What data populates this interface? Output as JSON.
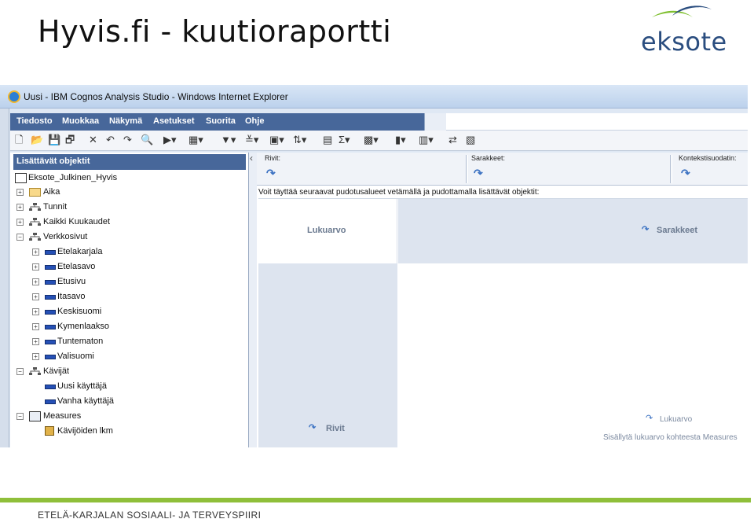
{
  "slide": {
    "title": "Hyvis.fi - kuutioraportti",
    "logo_text": "eksote",
    "footer": "ETELÄ-KARJALAN SOSIAALI- JA TERVEYSPIIRI",
    "colors": {
      "footer_bar": "#8fbf3a",
      "logo_green": "#7fbf2f",
      "logo_blue": "#2a4d7f"
    }
  },
  "window": {
    "title": "Uusi - IBM Cognos Analysis Studio - Windows Internet Explorer",
    "menu": [
      "Tiedosto",
      "Muokkaa",
      "Näkymä",
      "Asetukset",
      "Suorita",
      "Ohje"
    ],
    "colors": {
      "menubar": "#47679a",
      "accent": "#3c72c2"
    }
  },
  "panel": {
    "header": "Lisättävät objektit",
    "tree": {
      "root": "Eksote_Julkinen_Hyvis",
      "aika": "Aika",
      "tunnit": "Tunnit",
      "kuukaudet": "Kaikki Kuukaudet",
      "verkkosivut": "Verkkosivut",
      "etelakarjala": "Etelakarjala",
      "etelasavo": "Etelasavo",
      "etusivu": "Etusivu",
      "itasavo": "Itasavo",
      "keskisuomi": "Keskisuomi",
      "kymenlaakso": "Kymenlaakso",
      "tuntematon": "Tuntematon",
      "valisuomi": "Valisuomi",
      "kavijat": "Kävijät",
      "uusi": "Uusi käyttäjä",
      "vanha": "Vanha käyttäjä",
      "measures": "Measures",
      "lkm": "Kävijöiden lkm"
    }
  },
  "dropzones": {
    "rows": "Rivit:",
    "columns": "Sarakkeet:",
    "context": "Kontekstisuodatin:"
  },
  "crosstab": {
    "hint": "Voit täyttää seuraavat pudotusalueet vetämällä ja pudottamalla lisättävät objektit:",
    "measure_label": "Lukuarvo",
    "columns_label": "Sarakkeet",
    "rows_label": "Rivit",
    "measure_drop": "Lukuarvo",
    "measure_hint": "Sisällytä lukuarvo kohteesta Measures"
  }
}
